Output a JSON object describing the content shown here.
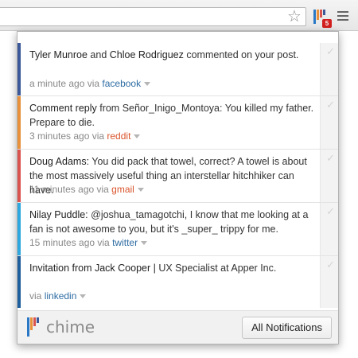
{
  "colors": {
    "facebook": "#3b5998",
    "reddit": "#e8913a",
    "gmail": "#d9534f",
    "twitter": "#2fa8df",
    "linkedin": "#1f5f9e",
    "badge": "#d21f1f"
  },
  "browser": {
    "extension_badge": "5",
    "icons": [
      "star-icon",
      "chime-extension-icon",
      "menu-icon"
    ]
  },
  "notifications": [
    {
      "name1": "Tyler Munroe",
      "joiner": " and ",
      "name2": "Chloe Rodriguez",
      "message": " commented on your post.",
      "time": "a minute ago via ",
      "source": "facebook"
    },
    {
      "title": "Comment reply",
      "message": " from Señor_Inigo_Montoya: You killed my father. Prepare to die.",
      "time": "3 minutes ago via ",
      "source": "reddit"
    },
    {
      "title": "Doug Adams:",
      "message": " You did pack that towel, correct? A towel is about the most massively useful thing an interstellar hitchhiker can have.",
      "time": "11 minutes ago via ",
      "source": "gmail"
    },
    {
      "title": "Nilay Puddle:",
      "message": " @joshua_tamagotchi, I know that me looking at a fan is not awesome to you, but it's _super_ trippy for me.",
      "time": "15 minutes ago via ",
      "source": "twitter"
    },
    {
      "title": "Invitation from Jack Cooper |",
      "message": " UX Specialist at Apper Inc.",
      "time": "via ",
      "source": "linkedin"
    }
  ],
  "footer": {
    "logo_text": "chime",
    "all_button": "All Notifications"
  },
  "check_glyph": "✓"
}
